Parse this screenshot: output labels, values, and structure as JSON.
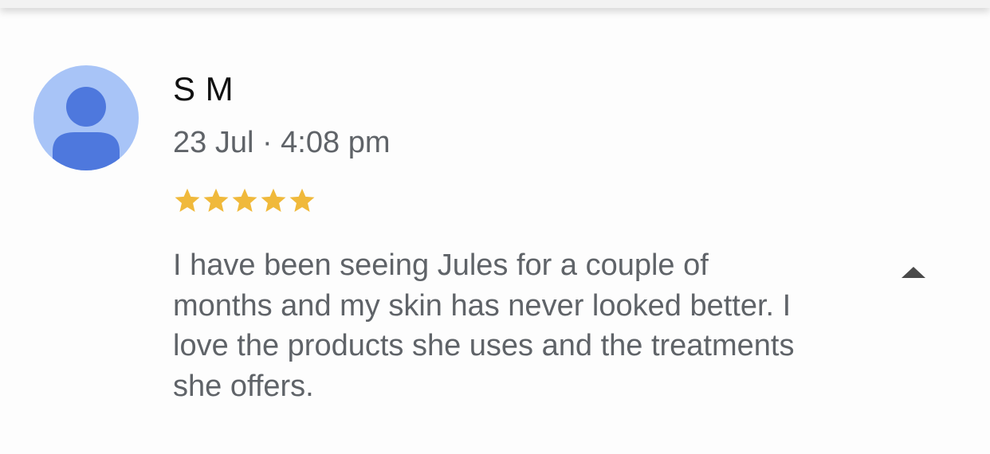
{
  "review": {
    "author": "S M",
    "timestamp": "23 Jul · 4:08 pm",
    "rating": 5,
    "rating_max": 5,
    "text": "I have been seeing Jules for a couple of months and my skin has never looked better. I love the products she uses and the treatments she offers."
  },
  "avatar": {
    "icon": "person-icon",
    "background_color": "#a8c4f7",
    "figure_color": "#4e78dd"
  },
  "colors": {
    "star": "#f0b93b",
    "secondary_text": "#5f6368",
    "primary_text": "#111111"
  },
  "collapse_toggle": {
    "icon": "chevron-up-icon"
  }
}
